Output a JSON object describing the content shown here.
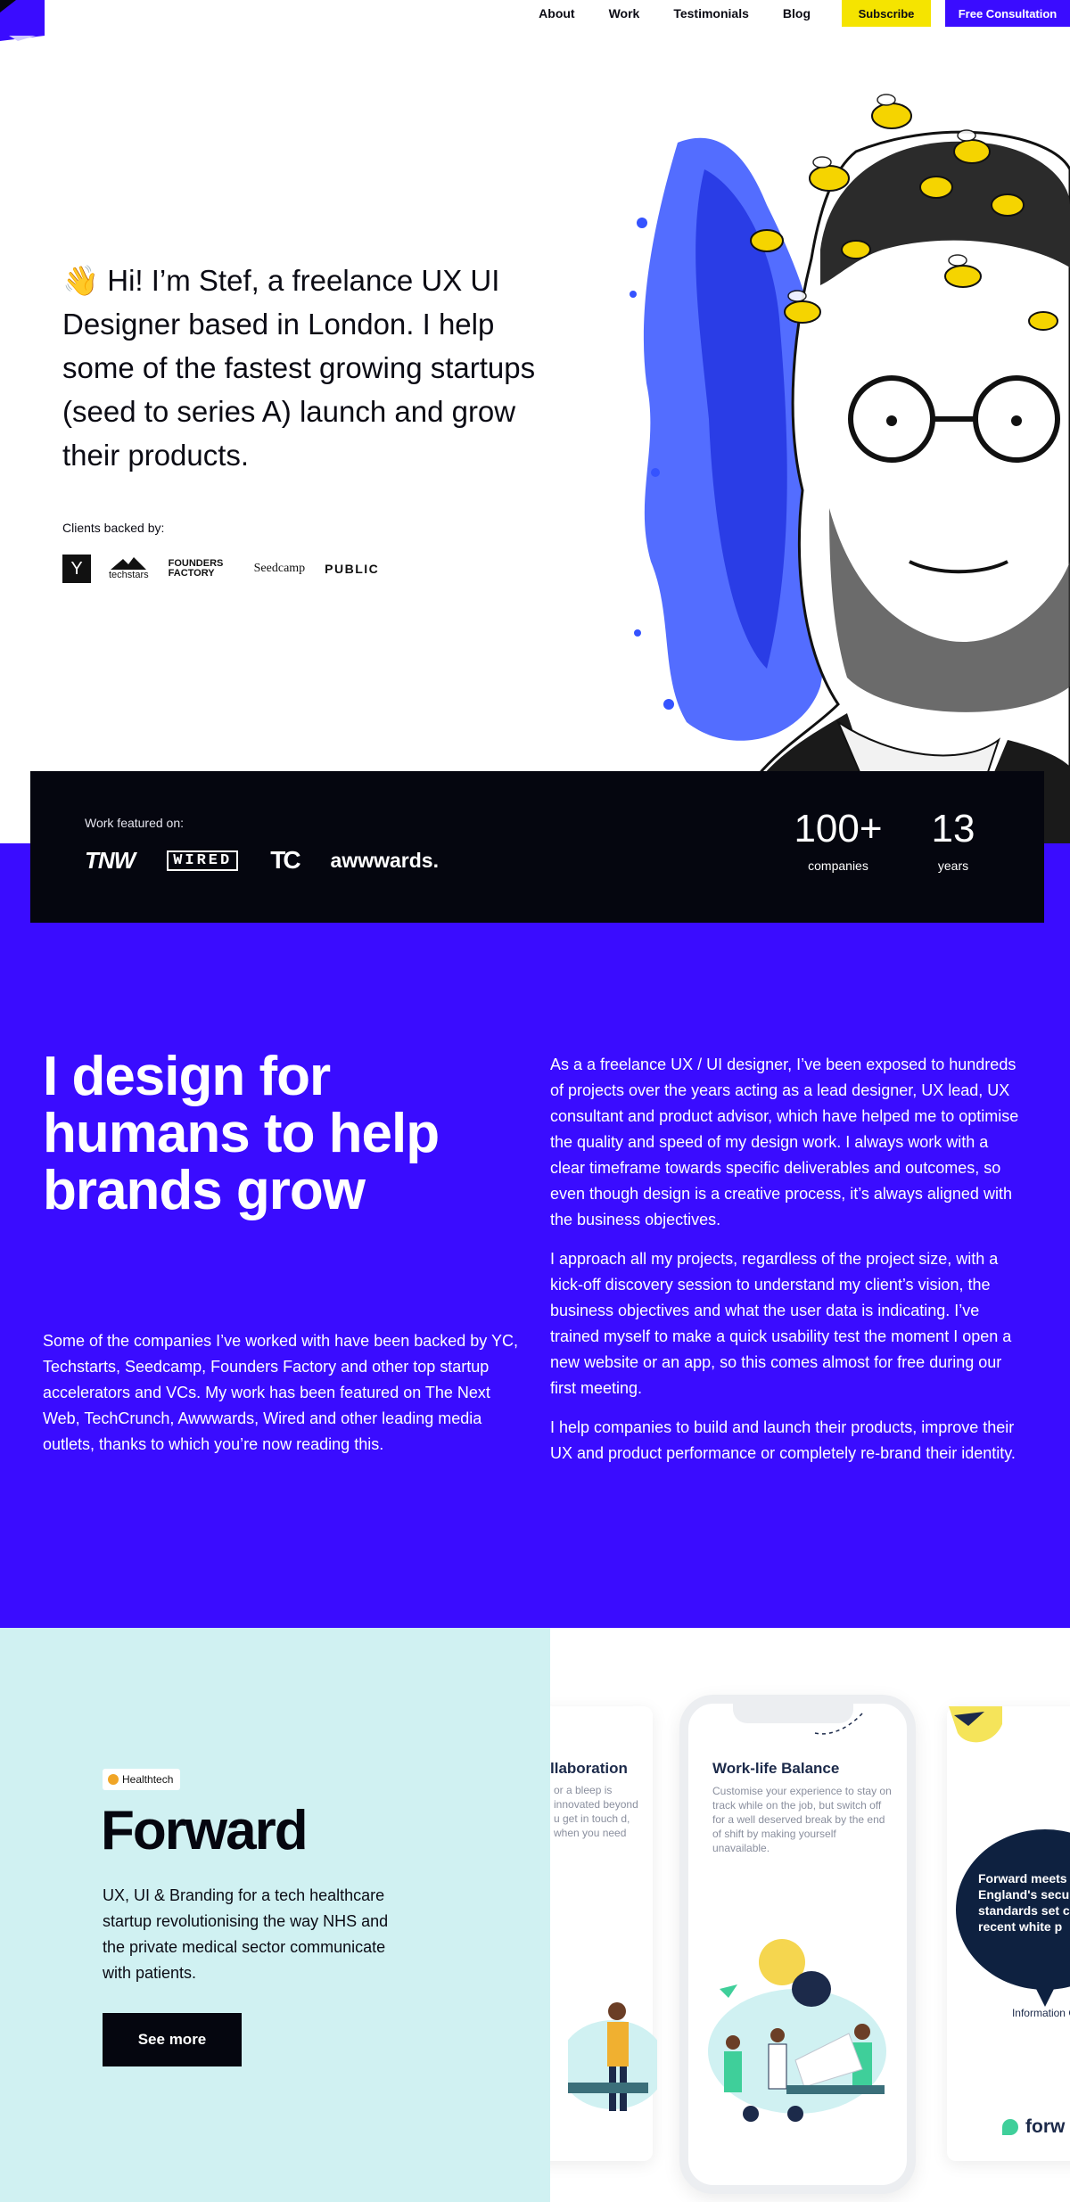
{
  "nav": {
    "links": [
      "About",
      "Work",
      "Testimonials",
      "Blog"
    ],
    "subscribe": "Subscribe",
    "consultation": "Free Consultation"
  },
  "hero": {
    "emoji": "👋",
    "text": "Hi! I’m Stef, a freelance UX UI Designer based in London. I help some of the fastest growing startups (seed to series A) launch and grow their products.",
    "clients_label": "Clients backed by:",
    "clients": [
      "Y",
      "techstars",
      "FOUNDERS FACTORY",
      "Seedcamp",
      "PUBLIC"
    ]
  },
  "featured": {
    "label": "Work featured on:",
    "press": [
      "TNW",
      "WIRED",
      "TC",
      "awwwards."
    ],
    "stats": [
      {
        "value": "100+",
        "label": "companies"
      },
      {
        "value": "13",
        "label": "years"
      }
    ]
  },
  "about": {
    "heading": "I design for humans to help brands grow",
    "left": "Some of the companies I’ve worked with have been backed by YC, Techstarts, Seedcamp, Founders Factory and other top startup accelerators and VCs. My work has been featured on The Next Web, TechCrunch, Awwwards, Wired and other leading media outlets, thanks to which you’re now reading this.",
    "right": [
      "As a a freelance UX / UI designer, I’ve been exposed to hundreds of projects over the years acting as a lead designer, UX lead, UX consultant and product advisor, which have helped me to optimise the quality and speed of my design work. I always work with a clear timeframe towards specific deliverables and outcomes, so even though design is a creative process, it’s always aligned with the business objectives.",
      "I approach all my projects, regardless of the project size, with a kick-off discovery session to understand my client’s vision, the business objectives and what the user data is indicating. I’ve trained myself to make a quick usability test the moment I open a new website or an app, so this comes almost for free during our first meeting.",
      "I help companies to build and launch their products, improve their UX and product performance or completely re-brand their identity."
    ]
  },
  "case": {
    "badge": "Healthtech",
    "title": "Forward",
    "description": "UX, UI & Branding for a tech healthcare startup revolutionising the way NHS and the private medical sector communicate with patients.",
    "cta": "See more",
    "cards": {
      "left_title": "llaboration",
      "left_body": "or a bleep is innovated beyond u get in touch d, when you need",
      "phone_title": "Work-life Balance",
      "phone_body": "Customise your experience to stay on track while on the job, but switch off for a well deserved break by the end of shift by making yourself unavailable.",
      "bubble": "Forward meets England's secu standards set c recent white p",
      "info": "Information Gov NHS Engla",
      "logo": "forw"
    }
  },
  "colors": {
    "accent_blue": "#3a0cff",
    "accent_yellow": "#f5e400",
    "dark": "#05060f",
    "mint": "#d0f1f2"
  }
}
